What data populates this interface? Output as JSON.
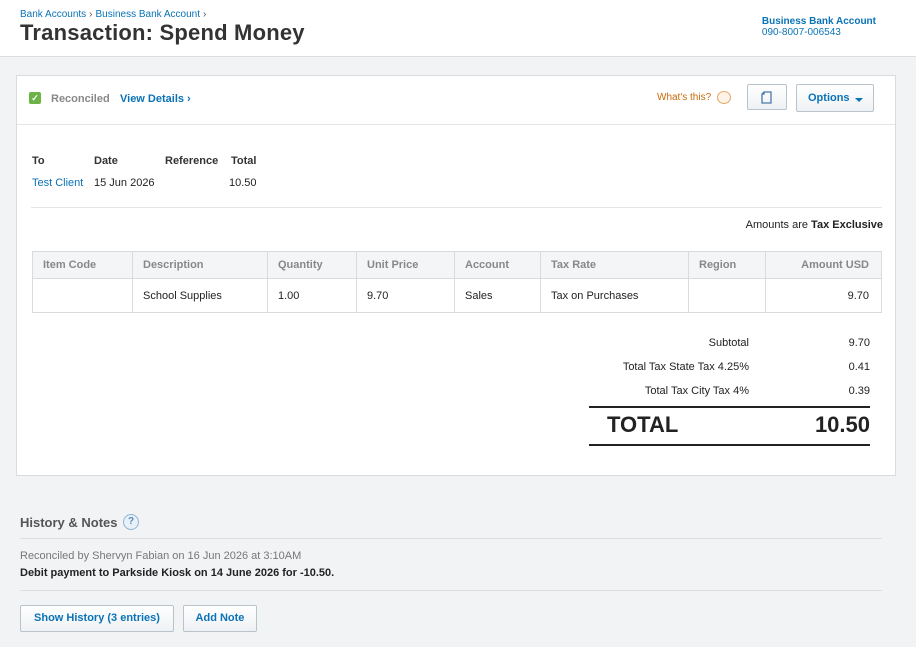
{
  "breadcrumb": [
    "Bank Accounts",
    "Business Bank Account"
  ],
  "page": {
    "title": "Transaction: Spend Money"
  },
  "account": {
    "name": "Business Bank Account",
    "number": "090-8007-006543"
  },
  "status": {
    "label": "Reconciled",
    "view_details": "View Details ›",
    "whats_this": "What's this?",
    "options_label": "Options"
  },
  "meta": {
    "headers": [
      "To",
      "Date",
      "Reference",
      "Total"
    ],
    "to": "Test Client",
    "date": "15 Jun 2026",
    "reference": "",
    "total": "10.50"
  },
  "amounts_note": {
    "prefix": "Amounts are ",
    "mode": "Tax Exclusive"
  },
  "table": {
    "headers": [
      "Item Code",
      "Description",
      "Quantity",
      "Unit Price",
      "Account",
      "Tax Rate",
      "Region",
      "Amount USD"
    ],
    "rows": [
      [
        "",
        "School Supplies",
        "1.00",
        "9.70",
        "Sales",
        "Tax on Purchases",
        "",
        "9.70"
      ]
    ]
  },
  "totals": {
    "subtotal_label": "Subtotal",
    "subtotal": "9.70",
    "tax1_label": "Total Tax State Tax 4.25%",
    "tax1": "0.41",
    "tax2_label": "Total Tax City Tax 4%",
    "tax2": "0.39",
    "total_label": "TOTAL",
    "total": "10.50"
  },
  "history": {
    "title": "History & Notes",
    "help": "?",
    "line1": "Reconciled by Shervyn Fabian on 16 Jun 2026 at 3:10AM",
    "line2": "Debit payment to Parkside Kiosk on 14 June 2026 for -10.50.",
    "show_history": "Show History (3 entries)",
    "add_note": "Add Note"
  },
  "colors": {
    "link": "#0a73b7",
    "check": "#6cb247",
    "whats_this": "#c76a0a"
  }
}
